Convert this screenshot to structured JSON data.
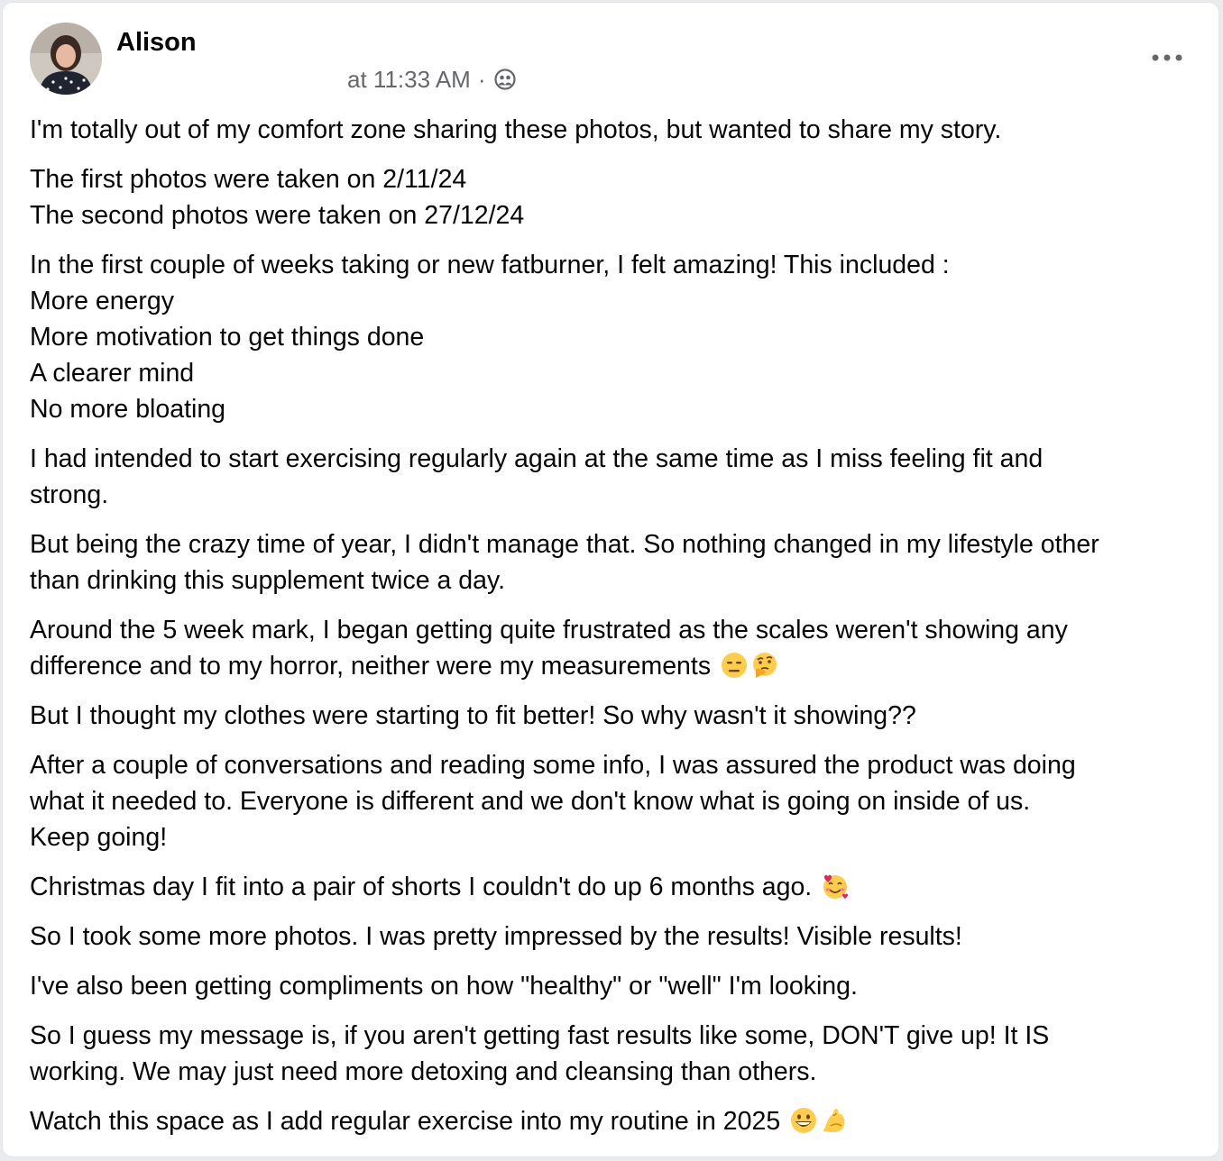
{
  "post": {
    "author": "Alison",
    "timestamp": "at 11:33 AM",
    "separator": "·",
    "audience_icon": "friends-icon",
    "more_icon": "more-options-icon",
    "paragraphs": [
      {
        "lines": [
          "I'm totally out of my comfort zone sharing these photos, but wanted to share my story."
        ]
      },
      {
        "lines": [
          "The first photos were taken on 2/11/24",
          "The second photos were taken on 27/12/24"
        ]
      },
      {
        "lines": [
          "In the first couple of weeks taking or new fatburner, I felt amazing! This included :",
          "More energy",
          "More motivation to get things done",
          "A clearer mind",
          "No more bloating"
        ]
      },
      {
        "lines": [
          "I had intended to start exercising regularly again at the same time as I miss feeling fit and",
          "strong."
        ]
      },
      {
        "lines": [
          "But being the crazy time of year, I didn't manage that. So nothing changed in my lifestyle other",
          "than drinking this supplement twice a day."
        ]
      },
      {
        "lines": [
          "Around the 5 week mark, I began getting quite frustrated as the scales weren't showing any",
          "difference and to my horror, neither were my measurements"
        ]
      },
      {
        "lines": [
          "But I thought my clothes were starting to fit better! So why wasn't it showing??"
        ]
      },
      {
        "lines": [
          "After a couple of conversations and reading some info, I was assured the product was doing",
          "what it needed to. Everyone is different and we don't know what is going on inside of us.",
          "Keep going!"
        ]
      },
      {
        "lines": [
          "Christmas day I fit into a pair of shorts I couldn't do up 6 months ago."
        ]
      },
      {
        "lines": [
          "So I took some more photos. I was pretty impressed by the results! Visible results!"
        ]
      },
      {
        "lines": [
          "I've also been getting compliments on how \"healthy\" or \"well\" I'm looking."
        ]
      },
      {
        "lines": [
          "So I guess my message is, if you aren't getting fast results like some, DON'T  give up! It IS",
          "working. We may just need more detoxing and cleansing than others."
        ]
      },
      {
        "lines": [
          "Watch this space as I add regular exercise into my routine in 2025"
        ]
      }
    ],
    "emojis": {
      "measurements": [
        "expressionless-face-emoji",
        "thinking-face-emoji"
      ],
      "shorts": [
        "smiling-face-with-hearts-emoji"
      ],
      "exercise": [
        "grinning-face-emoji",
        "flexed-biceps-emoji"
      ]
    }
  },
  "colors": {
    "text": "#050505",
    "secondary_text": "#65676b",
    "card_background": "#ffffff",
    "page_background": "#e9ebee"
  }
}
